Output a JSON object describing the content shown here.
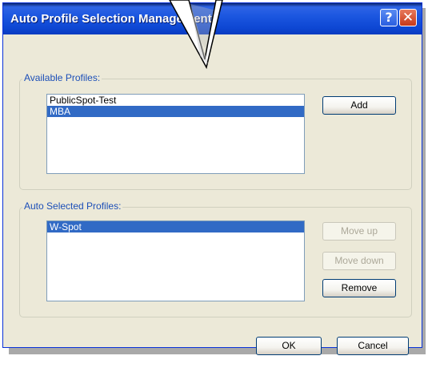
{
  "window": {
    "title": "Auto Profile Selection Management"
  },
  "title_buttons": {
    "help_glyph": "?",
    "close_glyph": "✕"
  },
  "available_profiles": {
    "label": "Available Profiles:",
    "items": [
      "PublicSpot-Test",
      "MBA"
    ],
    "selected_index": 1,
    "add_label": "Add"
  },
  "auto_selected_profiles": {
    "label": "Auto Selected Profiles:",
    "items": [
      "W-Spot"
    ],
    "selected_index": 0,
    "move_up_label": "Move up",
    "move_down_label": "Move down",
    "remove_label": "Remove"
  },
  "footer": {
    "ok_label": "OK",
    "cancel_label": "Cancel"
  },
  "colors": {
    "title_bar": "#1c57e0",
    "dialog_bg": "#ece9d8",
    "selection": "#316ac5",
    "group_label": "#1c4fb8"
  }
}
